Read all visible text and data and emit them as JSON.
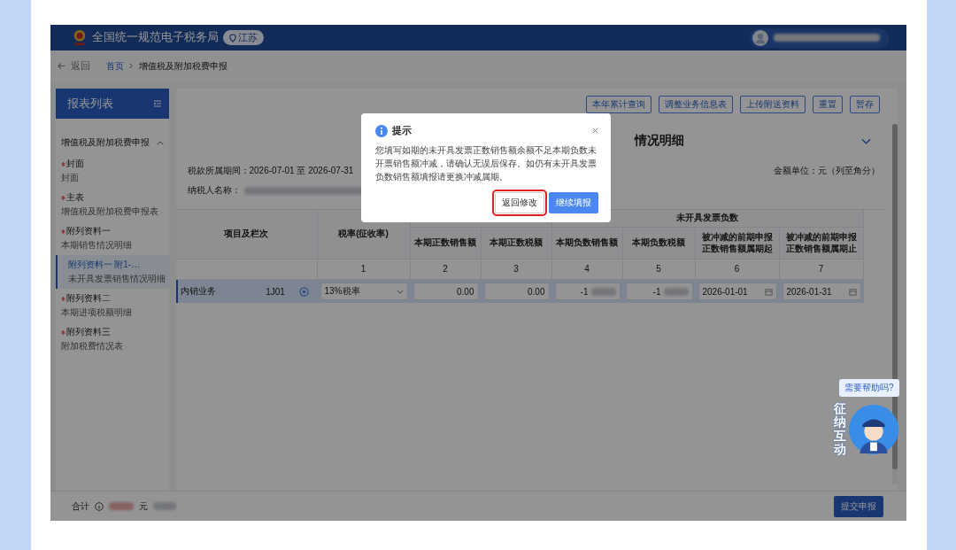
{
  "header": {
    "title": "全国统一规范电子税务局",
    "region": "江苏"
  },
  "breadcrumb": {
    "back": "返回",
    "items": [
      "首页",
      "增值税及附加税费申报"
    ]
  },
  "sidebar": {
    "title": "报表列表",
    "group": {
      "label": "增值税及附加税费申报",
      "expanded": true,
      "items": [
        {
          "title": "封面",
          "subtitle": "封面",
          "required": true,
          "selected": false
        },
        {
          "title": "主表",
          "subtitle": "增值税及附加税费申报表",
          "required": true,
          "selected": false
        },
        {
          "title": "附列资料一",
          "subtitle": "本期销售情况明细",
          "required": true,
          "selected": false,
          "children": [
            {
              "title": "附列资料一 附1-…",
              "subtitle": "未开具发票销售情况明细",
              "required": false,
              "selected": true
            }
          ]
        },
        {
          "title": "附列资料二",
          "subtitle": "本期进项税额明细",
          "required": true,
          "selected": false
        },
        {
          "title": "附列资料三",
          "subtitle": "附加税费情况表",
          "required": true,
          "selected": false
        }
      ]
    }
  },
  "toolbar": [
    "本年累计查询",
    "调整业务信息表",
    "上传附送资料",
    "重置",
    "暂存"
  ],
  "form": {
    "title": "情况明细",
    "expanded": true,
    "period_label": "税款所属期间：",
    "period": "2026-07-01 至 2026-07-31",
    "taxpayer_label": "纳税人名称：",
    "unit": "金额单位：元（列至角分）"
  },
  "table": {
    "item_header": "项目及栏次",
    "rate_header": "税率(征收率)",
    "group_header": "未开具发票负数",
    "columns": [
      {
        "label": "本期正数销售额",
        "number": "2"
      },
      {
        "label": "本期正数税额",
        "number": "3"
      },
      {
        "label": "本期负数销售额",
        "number": "4"
      },
      {
        "label": "本期负数税额",
        "number": "5"
      },
      {
        "label": "被冲减的前期申报正数销售额属期起",
        "number": "6"
      },
      {
        "label": "被冲减的前期申报正数销售额属期止",
        "number": "7"
      }
    ],
    "rate_number": "1",
    "rows": [
      {
        "item": "内销业务",
        "code": "1J01",
        "selected": true,
        "rate": "13%税率",
        "cells": [
          {
            "kind": "amount",
            "value": "0.00"
          },
          {
            "kind": "amount",
            "value": "0.00"
          },
          {
            "kind": "masked",
            "value": "-1"
          },
          {
            "kind": "masked",
            "value": "-1"
          },
          {
            "kind": "date",
            "value": "2026-01-01"
          },
          {
            "kind": "date",
            "value": "2026-01-31"
          }
        ]
      }
    ]
  },
  "footer": {
    "total_label": "合计",
    "currency": "元",
    "submit": "提交申报"
  },
  "assistant": {
    "bubble": "需要帮助吗?",
    "label": "征纳互动"
  },
  "dialog": {
    "title": "提示",
    "message": "您填写如期的未开具发票正数销售额余额不足本期负数未开票销售额冲减，请确认无误后保存。如仍有未开具发票负数销售额填报请更换冲减属期。",
    "buttons": [
      {
        "label": "返回修改",
        "kind": "default",
        "highlighted": true
      },
      {
        "label": "继续填报",
        "kind": "primary",
        "highlighted": false
      }
    ]
  }
}
